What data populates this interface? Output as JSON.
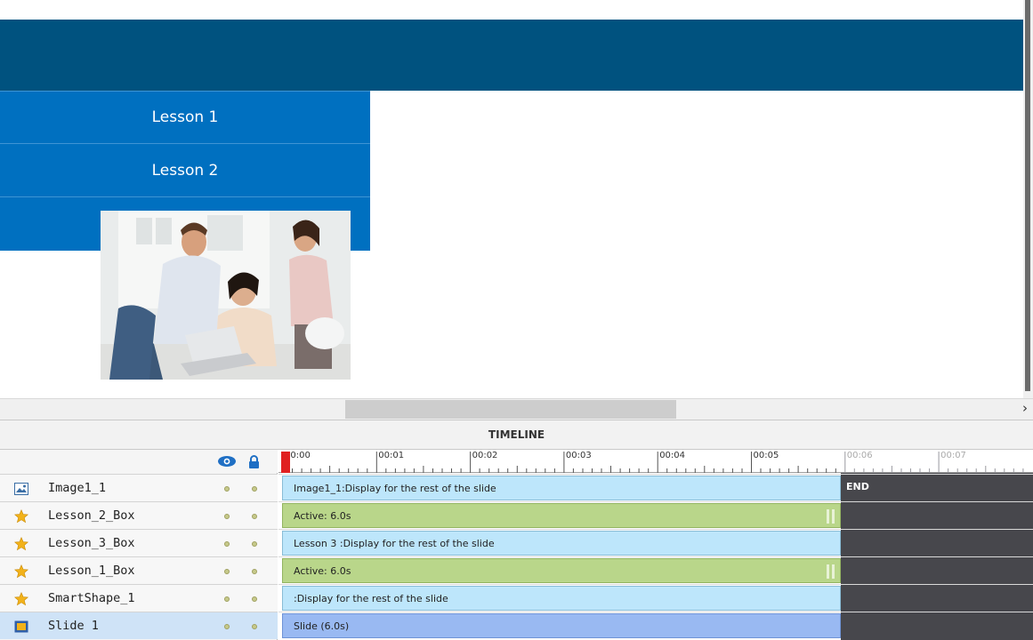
{
  "stage": {
    "lessons": [
      {
        "label": "Lesson 1"
      },
      {
        "label": "Lesson 2"
      },
      {
        "label": ""
      }
    ]
  },
  "scrollbar": {
    "right_arrow": "›"
  },
  "timeline": {
    "title": "TIMELINE",
    "ruler_ticks": [
      "00:00",
      "00:01",
      "00:02",
      "00:03",
      "00:04",
      "00:05",
      "00:06",
      "00:07"
    ],
    "end_label": "END",
    "layers": [
      {
        "name": "Image1_1",
        "icon": "image-icon",
        "bar_text": "Image1_1:Display for the rest of the slide",
        "bar_type": "blue",
        "paused": false
      },
      {
        "name": "Lesson_2_Box",
        "icon": "star-icon",
        "bar_text": "Active: 6.0s",
        "bar_type": "green",
        "paused": true
      },
      {
        "name": "Lesson_3_Box",
        "icon": "star-icon",
        "bar_text": "Lesson 3 :Display for the rest of the slide",
        "bar_type": "blue",
        "paused": false
      },
      {
        "name": "Lesson_1_Box",
        "icon": "star-icon",
        "bar_text": "Active: 6.0s",
        "bar_type": "green",
        "paused": true
      },
      {
        "name": "SmartShape_1",
        "icon": "star-icon",
        "bar_text": " :Display for the rest of the slide",
        "bar_type": "blue",
        "paused": false
      },
      {
        "name": "Slide 1",
        "icon": "slide-icon",
        "bar_text": "Slide (6.0s)",
        "bar_type": "slide",
        "paused": false,
        "selected": true
      }
    ]
  },
  "colors": {
    "header_band": "#00527f",
    "lesson_button": "#0070c0",
    "active_bar": "#b9d68a",
    "display_bar": "#bde6fb",
    "slide_bar": "#99b9f2",
    "end_zone": "#47474c",
    "playhead": "#e02020"
  }
}
